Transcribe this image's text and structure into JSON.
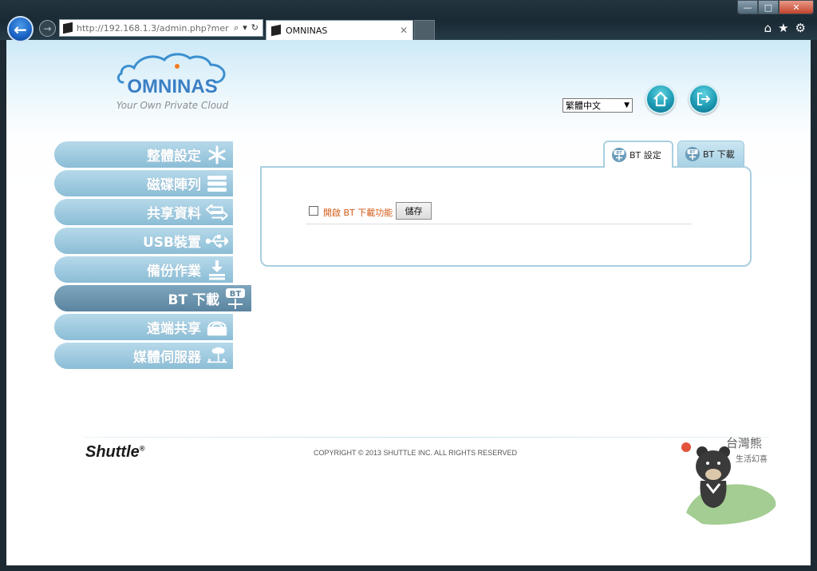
{
  "browser": {
    "url": "http://192.168.1.3/admin.php?mer",
    "tab_title": "OMNINAS",
    "tab_close": "✕",
    "back_icon": "←",
    "forward_icon": "→",
    "search_icon": "⌕",
    "dropdown_icon": "▾",
    "refresh_icon": "↻",
    "minimize": "—",
    "maximize": "□",
    "close": "✕",
    "home_icon": "⌂",
    "favorites_icon": "★",
    "settings_icon": "⚙"
  },
  "logo": {
    "word": "OMNINAS",
    "tagline": "Your Own Private Cloud"
  },
  "header": {
    "language": "繁體中文",
    "language_arrow": "▼",
    "home_button_icon": "home-icon",
    "logout_button_icon": "logout-icon"
  },
  "sidebar": {
    "items": [
      {
        "label": "整體設定",
        "icon": "settings-asterisk-icon",
        "active": false
      },
      {
        "label": "磁碟陣列",
        "icon": "disk-array-icon",
        "active": false
      },
      {
        "label": "共享資料",
        "icon": "share-arrows-icon",
        "active": false
      },
      {
        "label": "USB裝置",
        "icon": "usb-icon",
        "active": false
      },
      {
        "label": "備份作業",
        "icon": "backup-icon",
        "active": false
      },
      {
        "label": "BT 下載",
        "icon": "bt-download-icon",
        "active": true
      },
      {
        "label": "遠端共享",
        "icon": "remote-share-icon",
        "active": false
      },
      {
        "label": "媒體伺服器",
        "icon": "media-server-icon",
        "active": false
      }
    ]
  },
  "tabs": [
    {
      "label": "BT 設定",
      "active": true
    },
    {
      "label": "BT 下載",
      "active": false
    }
  ],
  "panel": {
    "checkbox_label": "開啟 BT 下載功能",
    "checkbox_checked": false,
    "save_label": "儲存"
  },
  "footer": {
    "brand": "Shuttle",
    "brand_mark": "®",
    "copyright": "COPYRIGHT © 2013 SHUTTLE INC. ALL RIGHTS RESERVED"
  },
  "watermark": {
    "title": "台灣熊",
    "subtitle": "生活幻喜"
  },
  "colors": {
    "accent": "#3b7fc4",
    "sidebar": "#8bbdd6",
    "sidebar_active": "#5b84a0",
    "checkbox_label": "#d25a16"
  }
}
